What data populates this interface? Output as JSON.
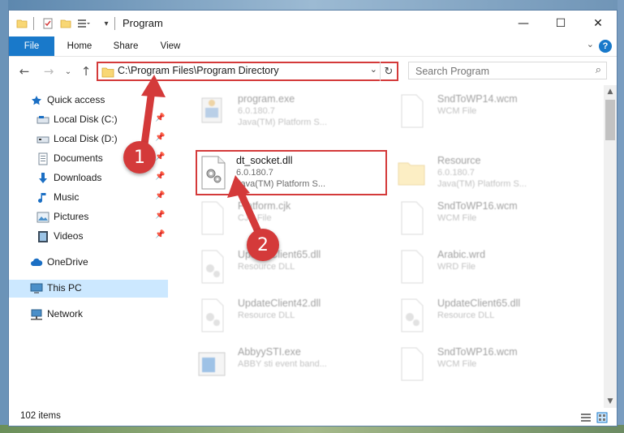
{
  "window": {
    "title": "Program",
    "controls": {
      "minimize": "—",
      "maximize": "☐",
      "close": "✕"
    }
  },
  "ribbon": {
    "tabs": [
      {
        "label": "File"
      },
      {
        "label": "Home"
      },
      {
        "label": "Share"
      },
      {
        "label": "View"
      }
    ],
    "help": "?"
  },
  "nav": {
    "address": "C:\\Program Files\\Program Directory",
    "search_placeholder": "Search Program"
  },
  "sidebar": {
    "items": [
      {
        "label": "Quick access",
        "icon": "star-icon",
        "pinned": false
      },
      {
        "label": "Local Disk (C:)",
        "icon": "drive-icon",
        "pinned": true
      },
      {
        "label": "Local Disk (D:)",
        "icon": "drive-icon",
        "pinned": true
      },
      {
        "label": "Documents",
        "icon": "documents-icon",
        "pinned": true
      },
      {
        "label": "Downloads",
        "icon": "download-icon",
        "pinned": true
      },
      {
        "label": "Music",
        "icon": "music-icon",
        "pinned": true
      },
      {
        "label": "Pictures",
        "icon": "pictures-icon",
        "pinned": true
      },
      {
        "label": "Videos",
        "icon": "videos-icon",
        "pinned": true
      },
      {
        "label": "OneDrive",
        "icon": "cloud-icon",
        "pinned": false
      },
      {
        "label": "This PC",
        "icon": "computer-icon",
        "pinned": false,
        "selected": true
      },
      {
        "label": "Network",
        "icon": "network-icon",
        "pinned": false
      }
    ]
  },
  "files": [
    {
      "name": "program.exe",
      "version": "6.0.180.7",
      "type": "Java(TM) Platform S...",
      "icon": "exe-icon"
    },
    {
      "name": "SndToWP14.wcm",
      "version": "WCM File",
      "type": "",
      "icon": "blank-file-icon"
    },
    {
      "name": "dt_socket.dll",
      "version": "6.0.180.7",
      "type": "Java(TM) Platform S...",
      "icon": "dll-icon"
    },
    {
      "name": "Resource",
      "version": "6.0.180.7",
      "type": "Java(TM) Platform S...",
      "icon": "folder-icon"
    },
    {
      "name": "Platform.cjk",
      "version": "CJK File",
      "type": "",
      "icon": "blank-file-icon"
    },
    {
      "name": "SndToWP16.wcm",
      "version": "WCM File",
      "type": "",
      "icon": "blank-file-icon"
    },
    {
      "name": "UpdateClient65.dll",
      "version": "Resource DLL",
      "type": "",
      "icon": "dll-icon"
    },
    {
      "name": "Arabic.wrd",
      "version": "WRD File",
      "type": "",
      "icon": "blank-file-icon"
    },
    {
      "name": "UpdateClient42.dll",
      "version": "Resource DLL",
      "type": "",
      "icon": "dll-icon"
    },
    {
      "name": "UpdateClient65.dll",
      "version": "Resource DLL",
      "type": "",
      "icon": "dll-icon"
    },
    {
      "name": "AbbyySTI.exe",
      "version": "ABBY sti event band...",
      "type": "",
      "icon": "app-icon"
    },
    {
      "name": "SndToWP16.wcm",
      "version": "WCM File",
      "type": "",
      "icon": "blank-file-icon"
    }
  ],
  "status": {
    "item_count": "102 items"
  },
  "callouts": [
    {
      "number": "1"
    },
    {
      "number": "2"
    }
  ],
  "colors": {
    "accent": "#1979ca",
    "annotation": "#d43a3a",
    "selected": "#cce8ff"
  }
}
